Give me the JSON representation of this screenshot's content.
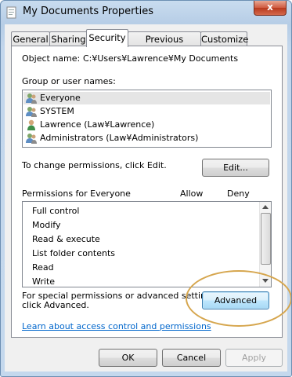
{
  "window": {
    "title": "My Documents Properties",
    "close_glyph": "x"
  },
  "tabs": [
    {
      "label": "General",
      "active": false
    },
    {
      "label": "Sharing",
      "active": false
    },
    {
      "label": "Security",
      "active": true
    },
    {
      "label": "Previous Versions",
      "active": false
    },
    {
      "label": "Customize",
      "active": false
    }
  ],
  "security": {
    "object_name_label": "Object name:",
    "object_name_value": "C:¥Users¥Lawrence¥My Documents",
    "group_label": "Group or user names:",
    "groups": [
      {
        "name": "Everyone",
        "icon": "users-group-icon",
        "selected": true
      },
      {
        "name": "SYSTEM",
        "icon": "users-group-icon",
        "selected": false
      },
      {
        "name": "Lawrence (Law¥Lawrence)",
        "icon": "user-icon",
        "selected": false
      },
      {
        "name": "Administrators (Law¥Administrators)",
        "icon": "users-group-icon",
        "selected": false
      }
    ],
    "change_text": "To change permissions, click Edit.",
    "edit_button": "Edit...",
    "permissions_label": "Permissions for Everyone",
    "allow_header": "Allow",
    "deny_header": "Deny",
    "permissions": [
      "Full control",
      "Modify",
      "Read & execute",
      "List folder contents",
      "Read",
      "Write"
    ],
    "special_text_1": "For special permissions or advanced settings,",
    "special_text_2": "click Advanced.",
    "advanced_button": "Advanced",
    "learn_link": "Learn about access control and permissions"
  },
  "footer": {
    "ok": "OK",
    "cancel": "Cancel",
    "apply": "Apply"
  },
  "colors": {
    "highlight_ellipse": "#d6a64e",
    "link": "#0066cc"
  }
}
